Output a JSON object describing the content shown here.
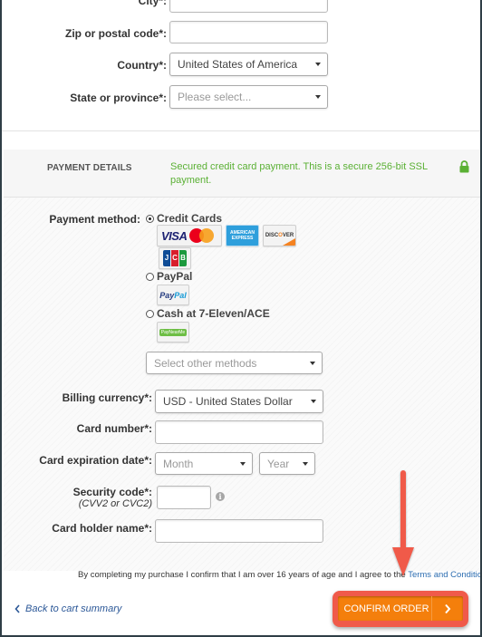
{
  "address": {
    "city_label": "City*:",
    "zip_label": "Zip or postal code*:",
    "country_label": "Country*:",
    "country_value": "United States of America",
    "state_label": "State or province*:",
    "state_placeholder": "Please select..."
  },
  "payment_header": {
    "title": "PAYMENT DETAILS",
    "secure_text": "Secured credit card payment. This is a secure 256-bit SSL payment.",
    "icon": "lock-icon",
    "secure_color": "#5ab034"
  },
  "payment": {
    "method_label": "Payment method:",
    "methods": [
      {
        "label": "Credit Cards",
        "selected": true,
        "logos": [
          "VISA",
          "MasterCard",
          "American Express",
          "DISCOVER",
          "JCB"
        ]
      },
      {
        "label": "PayPal",
        "selected": false,
        "logos": [
          "PayPal"
        ]
      },
      {
        "label": "Cash at 7-Eleven/ACE",
        "selected": false,
        "logos": [
          "PayNearMe"
        ]
      }
    ],
    "other_methods_placeholder": "Select other methods",
    "billing_currency_label": "Billing currency*:",
    "billing_currency_value": "USD - United States Dollar",
    "card_number_label": "Card number*:",
    "expiration_label": "Card expiration date*:",
    "month_placeholder": "Month",
    "year_placeholder": "Year",
    "security_code_label": "Security code*:",
    "security_code_sub": "(CVV2 or CVC2)",
    "holder_label": "Card holder name*:"
  },
  "footer": {
    "terms_prefix": "By completing my purchase I confirm that I am over 16 years of age and I agree to the ",
    "terms_link": "Terms and Conditions",
    "terms_suffix": ".",
    "back_label": "Back to cart summary",
    "confirm_label": "CONFIRM ORDER",
    "confirm_color": "#f47f0c",
    "highlight_color": "#f05a4a"
  }
}
